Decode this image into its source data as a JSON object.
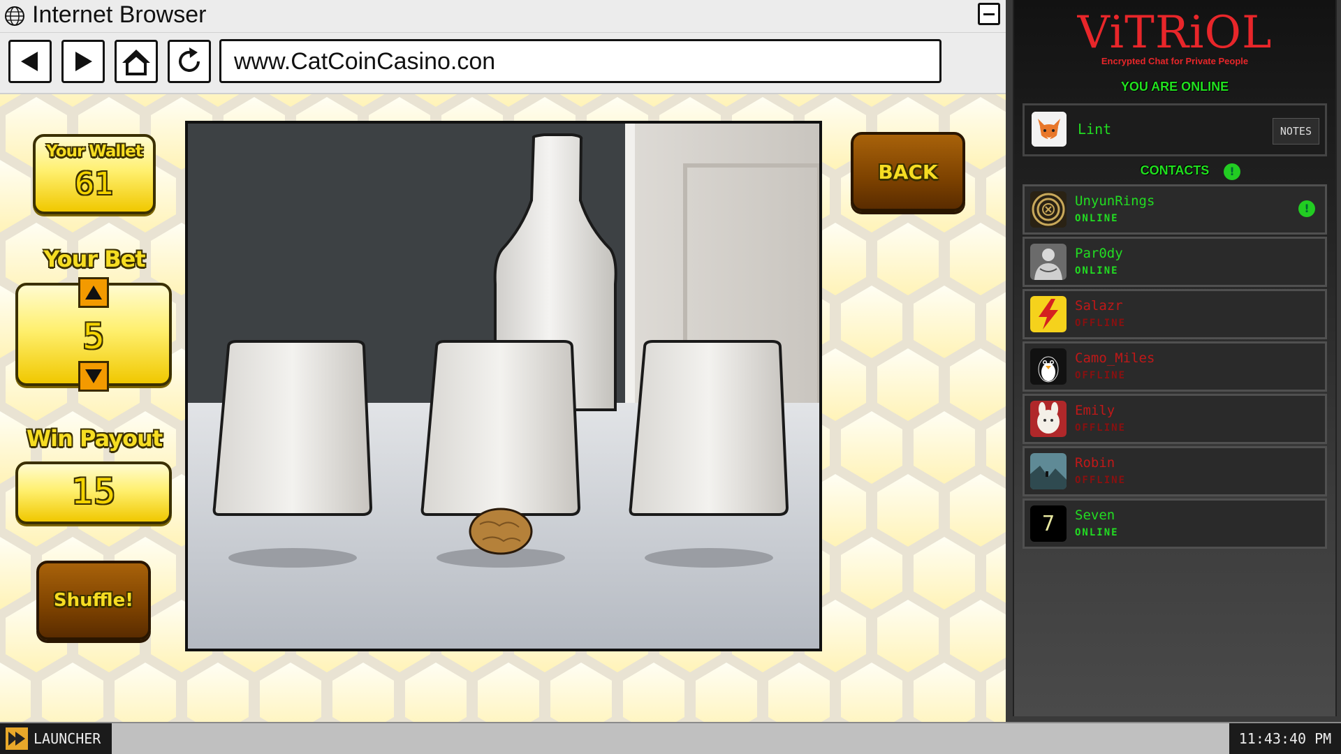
{
  "browser": {
    "title": "Internet Browser",
    "url": "www.CatCoinCasino.con",
    "nav_icons": [
      "back-arrow-icon",
      "forward-arrow-icon",
      "home-icon",
      "refresh-icon"
    ]
  },
  "casino": {
    "wallet_label": "Your Wallet",
    "wallet_value": "61",
    "bet_label": "Your Bet",
    "bet_value": "5",
    "payout_label": "Win Payout",
    "payout_value": "15",
    "shuffle_label": "Shuffle!",
    "back_label": "BACK"
  },
  "chat": {
    "app_name": "ViTRiOL",
    "tagline": "Encrypted Chat for Private People",
    "status": "YOU ARE ONLINE",
    "profile": {
      "name": "Lint",
      "notes_label": "NOTES"
    },
    "contacts_header": "CONTACTS",
    "alert_glyph": "!",
    "contacts": [
      {
        "name": "UnyunRings",
        "status": "ONLINE",
        "online": true,
        "alert": true
      },
      {
        "name": "Par0dy",
        "status": "ONLINE",
        "online": true,
        "alert": false
      },
      {
        "name": "Salazr",
        "status": "OFFLINE",
        "online": false,
        "alert": false
      },
      {
        "name": "Camo_Miles",
        "status": "OFFLINE",
        "online": false,
        "alert": false
      },
      {
        "name": "Emily",
        "status": "OFFLINE",
        "online": false,
        "alert": false
      },
      {
        "name": "Robin",
        "status": "OFFLINE",
        "online": false,
        "alert": false
      },
      {
        "name": "Seven",
        "status": "ONLINE",
        "online": true,
        "alert": false
      }
    ],
    "seven_avatar_glyph": "7"
  },
  "taskbar": {
    "launcher_label": "LAUNCHER",
    "clock": "11:43:40 PM"
  },
  "colors": {
    "online_green": "#22dd22",
    "offline_red": "#c01818",
    "logo_red": "#e8262a",
    "gold": "#f4d400",
    "brown_button": "#7d4200"
  }
}
